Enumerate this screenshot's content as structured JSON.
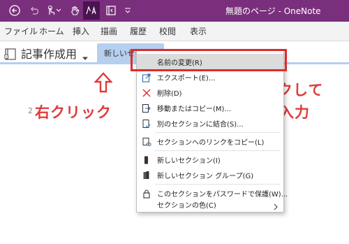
{
  "window": {
    "title": "無題のページ - OneNote"
  },
  "colors": {
    "titlebar": "#7a2f7c",
    "section_tab": "#b5cfee",
    "annotation": "#e03a3a",
    "highlight_frame": "#e02b2b"
  },
  "titlebar_icons": [
    "back-icon",
    "undo-icon",
    "touch-mode-icon",
    "pan-hand-icon",
    "lasso-select-icon",
    "full-page-view-icon",
    "quick-access-dropdown-icon"
  ],
  "ribbon": {
    "tabs": [
      "ファイル",
      "ホーム",
      "挿入",
      "描画",
      "履歴",
      "校閲",
      "表示"
    ]
  },
  "notebook": {
    "name": "記事作成用",
    "section_tab": "新しいセクション 1"
  },
  "page": {
    "date": "2"
  },
  "annotations": {
    "left": "右クリック",
    "right_line1": "クリックして",
    "right_line2": "名前を入力"
  },
  "context_menu": {
    "items": [
      {
        "label": "名前の変更(R)",
        "icon": "none",
        "highlighted": true
      },
      {
        "label": "エクスポート(E)...",
        "icon": "export-icon"
      },
      {
        "label": "削除(D)",
        "icon": "delete-x-icon"
      },
      {
        "label": "移動またはコピー(M)...",
        "icon": "move-copy-icon"
      },
      {
        "label": "別のセクションに結合(S)...",
        "icon": "merge-section-icon"
      },
      {
        "label": "セクションへのリンクをコピー(L)",
        "icon": "copy-link-icon"
      },
      {
        "label": "新しいセクション(I)",
        "icon": "new-section-icon"
      },
      {
        "label": "新しいセクション グループ(G)",
        "icon": "new-section-group-icon"
      },
      {
        "label": "このセクションをパスワードで保護(W)...",
        "icon": "lock-icon"
      },
      {
        "label": "セクションの色(C)",
        "icon": "none",
        "has_submenu": true
      }
    ]
  }
}
